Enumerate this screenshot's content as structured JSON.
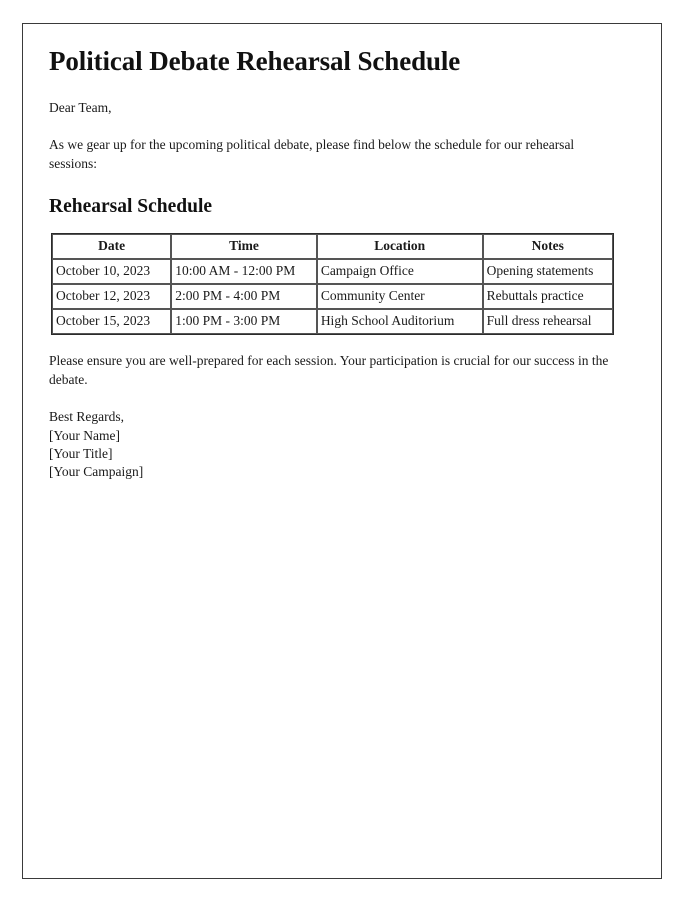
{
  "document": {
    "title": "Political Debate Rehearsal Schedule",
    "salutation": "Dear Team,",
    "intro_paragraph": "As we gear up for the upcoming political debate, please find below the schedule for our rehearsal sessions:",
    "section_heading": "Rehearsal Schedule",
    "closing_paragraph": "Please ensure you are well-prepared for each session. Your participation is crucial for our success in the debate.",
    "signature": {
      "closing": "Best Regards,",
      "name": "[Your Name]",
      "title": "[Your Title]",
      "organization": "[Your Campaign]"
    }
  },
  "schedule_table": {
    "columns": [
      "Date",
      "Time",
      "Location",
      "Notes"
    ],
    "rows": [
      {
        "date": "October 10, 2023",
        "time": "10:00 AM - 12:00 PM",
        "location": "Campaign Office",
        "notes": "Opening statements"
      },
      {
        "date": "October 12, 2023",
        "time": "2:00 PM - 4:00 PM",
        "location": "Community Center",
        "notes": "Rebuttals practice"
      },
      {
        "date": "October 15, 2023",
        "time": "1:00 PM - 3:00 PM",
        "location": "High School Auditorium",
        "notes": "Full dress rehearsal"
      }
    ]
  },
  "style": {
    "page_background": "#ffffff",
    "text_color": "#1a1a1a",
    "page_border_color": "#3a3a3a",
    "table_border_color": "#555555"
  }
}
